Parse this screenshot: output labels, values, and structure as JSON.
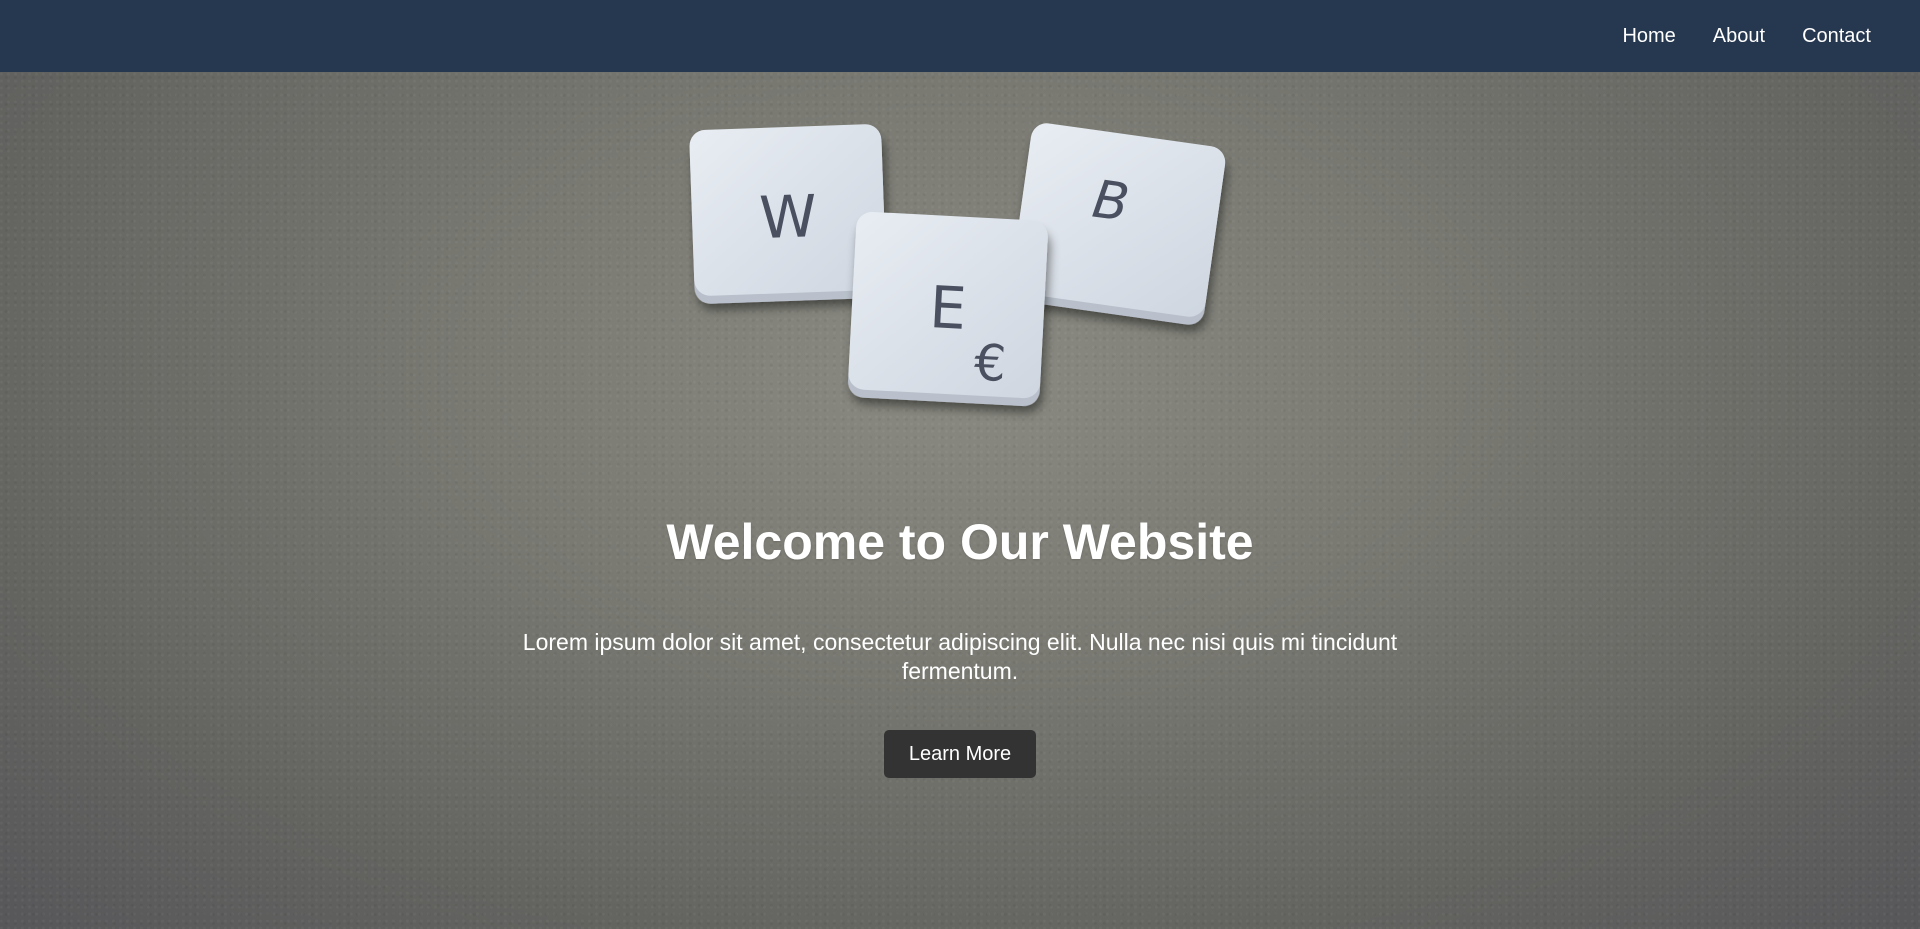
{
  "nav": {
    "items": [
      {
        "label": "Home"
      },
      {
        "label": "About"
      },
      {
        "label": "Contact"
      }
    ]
  },
  "hero": {
    "title": "Welcome to Our Website",
    "text": "Lorem ipsum dolor sit amet, consectetur adipiscing elit. Nulla nec nisi quis mi tincidunt fermentum.",
    "button_label": "Learn More",
    "image": {
      "subject": "letter-tiles",
      "tiles": [
        {
          "letter": "W"
        },
        {
          "letter": "E",
          "sub": "€"
        },
        {
          "letter": "B"
        }
      ]
    }
  },
  "colors": {
    "navbar": "#263750",
    "button": "#333333",
    "tile": "#dde3ec",
    "tile_letter": "#4a5060"
  }
}
